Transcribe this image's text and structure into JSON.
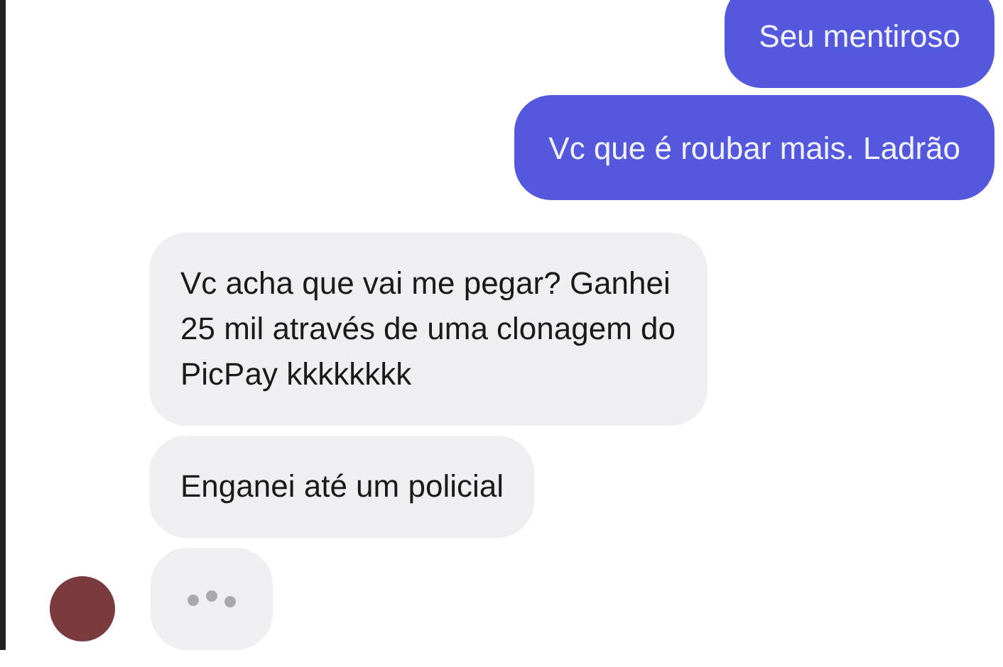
{
  "messages": [
    {
      "kind": "sent",
      "text": "Seu mentiroso"
    },
    {
      "kind": "sent",
      "text": "Vc que é roubar mais. Ladrão"
    },
    {
      "kind": "received",
      "text": "Vc acha que vai me pegar? Ganhei\n25 mil através de uma clonagem do\nPicPay kkkkkkkk"
    },
    {
      "kind": "received",
      "text": "Enganei até um policial"
    }
  ],
  "typing": true
}
